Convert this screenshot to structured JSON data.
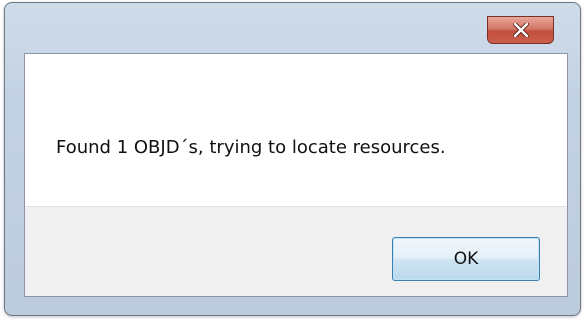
{
  "window": {
    "close_icon": "close-x-icon",
    "accent_close": "#c9604d"
  },
  "dialog": {
    "message": "Found 1 OBJD´s, trying to locate resources.",
    "ok_label": "OK"
  }
}
